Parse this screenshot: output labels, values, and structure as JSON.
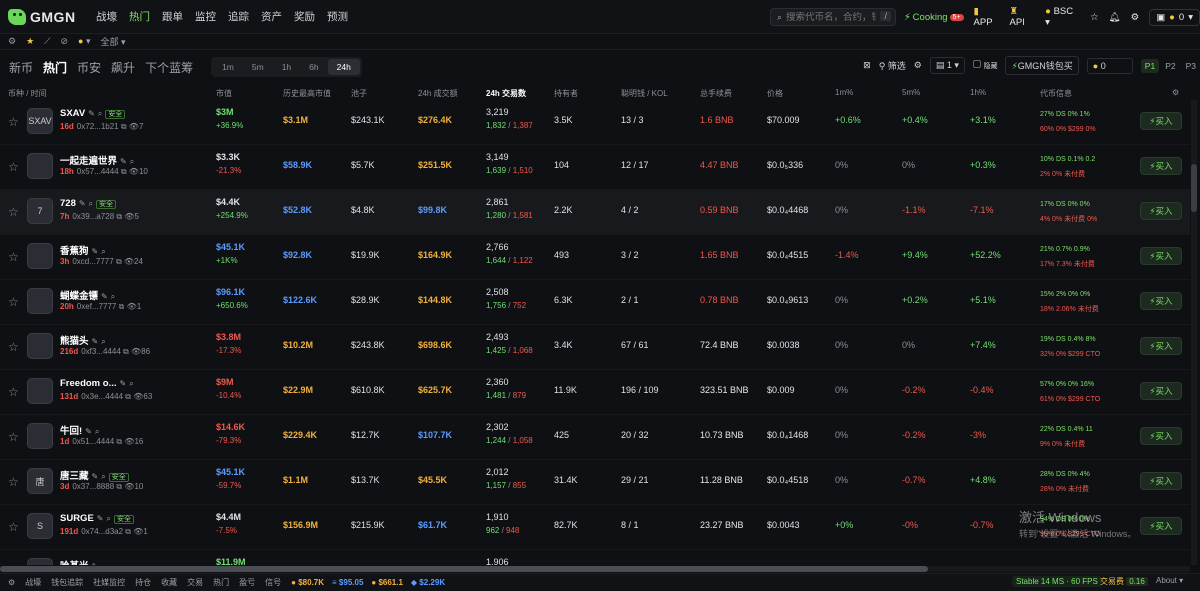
{
  "app": {
    "logo": "GMGN"
  },
  "nav": [
    "战壕",
    "热门",
    "跟单",
    "监控",
    "追踪",
    "资产",
    "奖励",
    "预测"
  ],
  "nav_active": 1,
  "search": {
    "placeholder": "搜索代币名，合约，钱包",
    "shortcut": "/"
  },
  "top_right": {
    "cooking": "Cooking",
    "cooking_badge": "5+",
    "app": "APP",
    "api": "API",
    "chain": "BSC",
    "wallet_count": "0"
  },
  "subbar": {
    "all_label": "全部"
  },
  "main_tabs": [
    "新币",
    "热门",
    "币安",
    "飙升",
    "下个蓝筹"
  ],
  "main_active": 1,
  "time_tabs": [
    "1m",
    "5m",
    "1h",
    "6h",
    "24h"
  ],
  "time_active": 4,
  "tools": {
    "filter": "筛选",
    "page_select": "1",
    "hide_label": "隐藏",
    "wallet_buy": "GMGN钱包买",
    "amount": "0",
    "presets": [
      "P1",
      "P2",
      "P3"
    ]
  },
  "columns": [
    "币种 / 时间",
    "市值",
    "历史最高市值",
    "池子",
    "24h 成交额",
    "24h 交易数",
    "持有者",
    "聪明钱 / KOL",
    "总手续费",
    "价格",
    "1m%",
    "5m%",
    "1h%",
    "代币信息"
  ],
  "buy_label": "买入",
  "rows": [
    {
      "name": "SXAV",
      "age": "16d",
      "addr": "0x72...1b21",
      "safe": "安全",
      "views": "7",
      "mcap": "$3M",
      "mchg": "+36.9%",
      "ath": "$3.1M",
      "pool": "$243.1K",
      "vol": "$276.4K",
      "tx": "3,219",
      "buys": "1,832",
      "sells": "1,387",
      "holders": "3.5K",
      "smart": "13 / 3",
      "fee": "1.6 BNB",
      "price": "$70.009",
      "c1m": "+0.6%",
      "c5m": "+0.4%",
      "c1h": "+3.1%",
      "info1": "27%  DS  0%  1%",
      "info2": "60%  0%  $299  0%",
      "avatar": "SXAV"
    },
    {
      "name": "一起走遍世界",
      "age": "18h",
      "addr": "0x57...4444",
      "safe": "",
      "views": "10",
      "mcap": "$3.3K",
      "mchg": "-21.3%",
      "ath": "$58.9K",
      "pool": "$5.7K",
      "vol": "$251.5K",
      "tx": "3,149",
      "buys": "1,639",
      "sells": "1,510",
      "holders": "104",
      "smart": "12 / 17",
      "fee": "4.47 BNB",
      "price": "$0.0₅336",
      "c1m": "0%",
      "c5m": "0%",
      "c1h": "+0.3%",
      "info1": "10%  DS  0.1%  0.2",
      "info2": "2%  0%  未付费",
      "avatar": ""
    },
    {
      "name": "728",
      "age": "7h",
      "addr": "0x39...a728",
      "safe": "安全",
      "views": "5",
      "mcap": "$4.4K",
      "mchg": "+254.9%",
      "ath": "$52.8K",
      "pool": "$4.8K",
      "vol": "$99.8K",
      "tx": "2,861",
      "buys": "1,280",
      "sells": "1,581",
      "holders": "2.2K",
      "smart": "4 / 2",
      "fee": "0.59 BNB",
      "price": "$0.0₄4468",
      "c1m": "0%",
      "c5m": "-1.1%",
      "c1h": "-7.1%",
      "info1": "17%  DS  0%  0%",
      "info2": "4%  0%  未付费  0%",
      "avatar": "7"
    },
    {
      "name": "香蕉狗",
      "age": "3h",
      "addr": "0xcd...7777",
      "safe": "",
      "views": "24",
      "mcap": "$45.1K",
      "mchg": "+1K%",
      "ath": "$92.8K",
      "pool": "$19.9K",
      "vol": "$164.9K",
      "tx": "2,766",
      "buys": "1,644",
      "sells": "1,122",
      "holders": "493",
      "smart": "3 / 2",
      "fee": "1.65 BNB",
      "price": "$0.0₄4515",
      "c1m": "-1.4%",
      "c5m": "+9.4%",
      "c1h": "+52.2%",
      "info1": "21%  0.7%  0.9%",
      "info2": "17%  7.3%  未付费",
      "avatar": ""
    },
    {
      "name": "蝴蝶金镖",
      "age": "20h",
      "addr": "0xef...7777",
      "safe": "",
      "views": "1",
      "mcap": "$96.1K",
      "mchg": "+650.6%",
      "ath": "$122.6K",
      "pool": "$28.9K",
      "vol": "$144.8K",
      "tx": "2,508",
      "buys": "1,756",
      "sells": "752",
      "holders": "6.3K",
      "smart": "2 / 1",
      "fee": "0.78 BNB",
      "price": "$0.0₄9613",
      "c1m": "0%",
      "c5m": "+0.2%",
      "c1h": "+5.1%",
      "info1": "15%  2%  0%  0%",
      "info2": "18%  2.06%  未付费",
      "avatar": ""
    },
    {
      "name": "熊猫头",
      "age": "216d",
      "addr": "0xf3...4444",
      "safe": "",
      "views": "86",
      "mcap": "$3.8M",
      "mchg": "-17.3%",
      "ath": "$10.2M",
      "pool": "$243.8K",
      "vol": "$698.6K",
      "tx": "2,493",
      "buys": "1,425",
      "sells": "1,068",
      "holders": "3.4K",
      "smart": "67 / 61",
      "fee": "72.4 BNB",
      "price": "$0.0038",
      "c1m": "0%",
      "c5m": "0%",
      "c1h": "+7.4%",
      "info1": "19%  DS  0.4%  8%",
      "info2": "32%  0%  $299 CTO",
      "avatar": ""
    },
    {
      "name": "Freedom o...",
      "age": "131d",
      "addr": "0x3e...4444",
      "safe": "",
      "views": "63",
      "mcap": "$9M",
      "mchg": "-10.4%",
      "ath": "$22.9M",
      "pool": "$610.8K",
      "vol": "$625.7K",
      "tx": "2,360",
      "buys": "1,481",
      "sells": "879",
      "holders": "11.9K",
      "smart": "196 / 109",
      "fee": "323.51 BNB",
      "price": "$0.009",
      "c1m": "0%",
      "c5m": "-0.2%",
      "c1h": "-0.4%",
      "info1": "57%  0%  0%  16%",
      "info2": "61%  0%  $299 CTO",
      "avatar": ""
    },
    {
      "name": "牛回!",
      "age": "1d",
      "addr": "0x51...4444",
      "safe": "",
      "views": "16",
      "mcap": "$14.6K",
      "mchg": "-79.3%",
      "ath": "$229.4K",
      "pool": "$12.7K",
      "vol": "$107.7K",
      "tx": "2,302",
      "buys": "1,244",
      "sells": "1,058",
      "holders": "425",
      "smart": "20 / 32",
      "fee": "10.73 BNB",
      "price": "$0.0₄1468",
      "c1m": "0%",
      "c5m": "-0.2%",
      "c1h": "-3%",
      "info1": "22%  DS  0.4%  11",
      "info2": "9%  0%  未付费",
      "avatar": ""
    },
    {
      "name": "唐三藏",
      "age": "3d",
      "addr": "0x37...8888",
      "safe": "安全",
      "views": "10",
      "mcap": "$45.1K",
      "mchg": "-59.7%",
      "ath": "$1.1M",
      "pool": "$13.7K",
      "vol": "$45.5K",
      "tx": "2,012",
      "buys": "1,157",
      "sells": "855",
      "holders": "31.4K",
      "smart": "29 / 21",
      "fee": "11.28 BNB",
      "price": "$0.0₄4518",
      "c1m": "0%",
      "c5m": "-0.7%",
      "c1h": "+4.8%",
      "info1": "28%  DS  0%  4%",
      "info2": "28%  0%  未付费",
      "avatar": "唐"
    },
    {
      "name": "SURGE",
      "age": "191d",
      "addr": "0x74...d3a2",
      "safe": "安全",
      "views": "1",
      "mcap": "$4.4M",
      "mchg": "-7.5%",
      "ath": "$156.9M",
      "pool": "$215.9K",
      "vol": "$61.7K",
      "tx": "1,910",
      "buys": "962",
      "sells": "948",
      "holders": "82.7K",
      "smart": "8 / 1",
      "fee": "23.27 BNB",
      "price": "$0.0043",
      "c1m": "+0%",
      "c5m": "-0%",
      "c1h": "-0.7%",
      "info1": "94%  DS  0%  0%",
      "info2": "95%  0%  $299 CTO",
      "avatar": "S"
    },
    {
      "name": "哈基米",
      "age": "",
      "addr": "",
      "safe": "",
      "views": "",
      "mcap": "$11.9M",
      "mchg": "",
      "ath": "",
      "pool": "",
      "vol": "",
      "tx": "1,906",
      "buys": "",
      "sells": "",
      "holders": "",
      "smart": "",
      "fee": "",
      "price": "",
      "c1m": "",
      "c5m": "",
      "c1h": "",
      "info1": "",
      "info2": "",
      "avatar": ""
    }
  ],
  "footer": {
    "items": [
      "战壕",
      "钱包追踪",
      "社媒监控",
      "持仓",
      "收藏",
      "交易",
      "热门",
      "盈亏",
      "信号"
    ],
    "btc": "$80.7K",
    "eth": "$95.05",
    "bnb": "$661.1",
    "sol": "$2.29K",
    "stable": "Stable 14 MS · 60 FPS",
    "txfee": "交易费",
    "txfee_badge": "0.16",
    "about": "About"
  },
  "watermark": {
    "line1": "激活 Windows",
    "line2": "转到\"设置\"以激活 Windows。"
  },
  "colors": {
    "accent": "#7ee16a",
    "up": "#6ee072",
    "down": "#f0594f",
    "bg": "#0f1013"
  }
}
